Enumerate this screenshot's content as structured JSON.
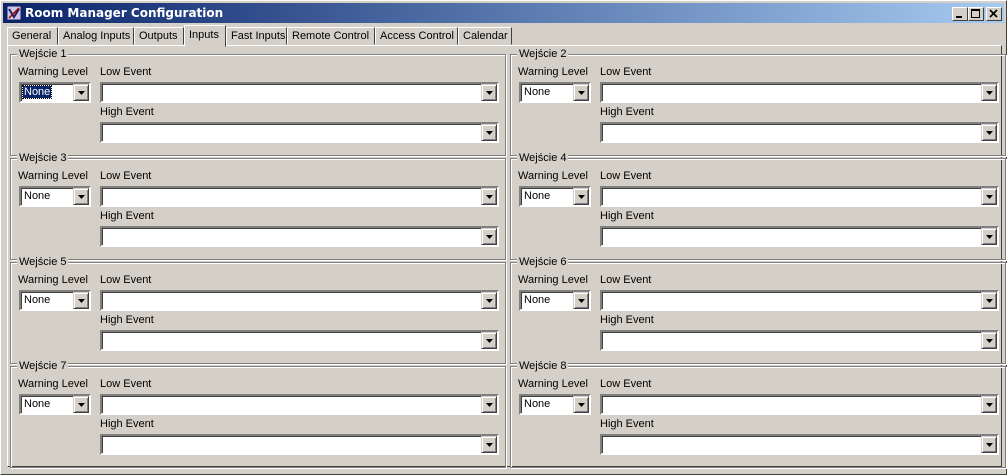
{
  "window": {
    "title": "Room Manager Configuration"
  },
  "tabs": [
    "General",
    "Analog Inputs",
    "Outputs",
    "Inputs",
    "Fast Inputs",
    "Remote Control",
    "Access Control",
    "Calendar"
  ],
  "active_tab": "Inputs",
  "labels": {
    "warning_level": "Warning Level",
    "low_event": "Low Event",
    "high_event": "High Event"
  },
  "groups": [
    {
      "title": "Wejście 1",
      "warning_level": "None",
      "low_event": "",
      "high_event": ""
    },
    {
      "title": "Wejście 2",
      "warning_level": "None",
      "low_event": "",
      "high_event": ""
    },
    {
      "title": "Wejście 3",
      "warning_level": "None",
      "low_event": "",
      "high_event": ""
    },
    {
      "title": "Wejście 4",
      "warning_level": "None",
      "low_event": "",
      "high_event": ""
    },
    {
      "title": "Wejście 5",
      "warning_level": "None",
      "low_event": "",
      "high_event": ""
    },
    {
      "title": "Wejście 6",
      "warning_level": "None",
      "low_event": "",
      "high_event": ""
    },
    {
      "title": "Wejście 7",
      "warning_level": "None",
      "low_event": "",
      "high_event": ""
    },
    {
      "title": "Wejście 8",
      "warning_level": "None",
      "low_event": "",
      "high_event": ""
    }
  ]
}
